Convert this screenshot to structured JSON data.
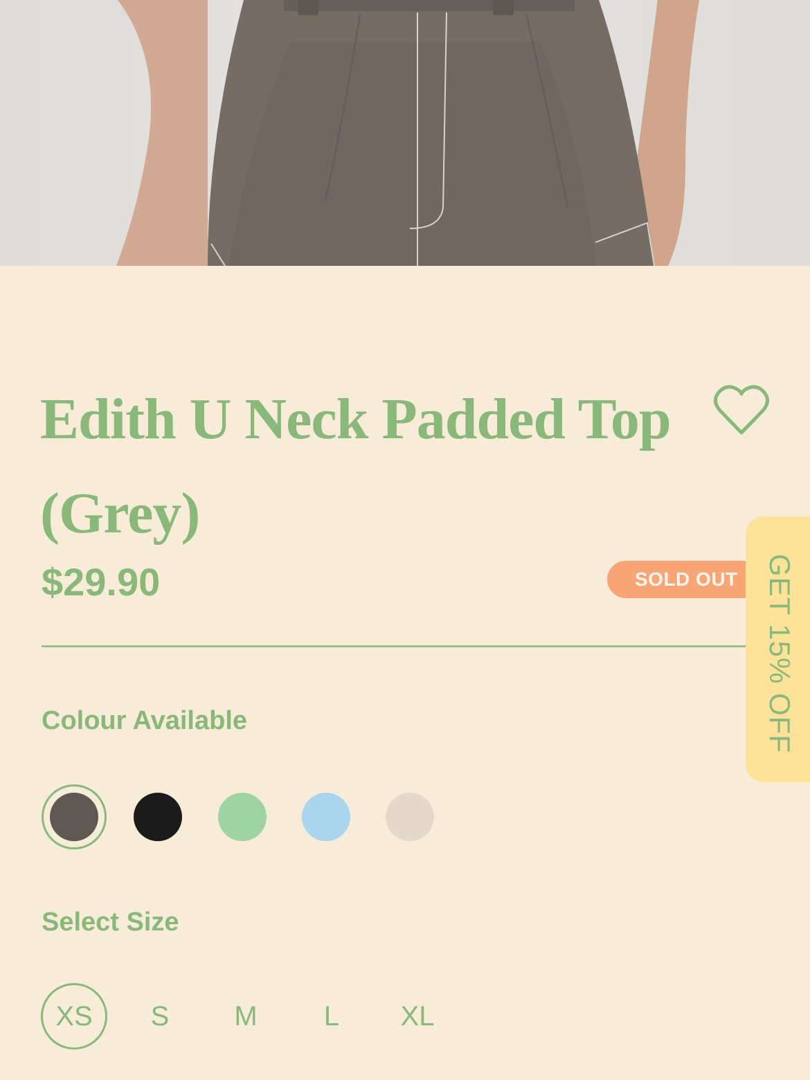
{
  "product": {
    "title": "Edith U Neck Padded Top (Grey)",
    "price": "$29.90",
    "status_badge": "SOLD OUT"
  },
  "colours": {
    "label": "Colour Available",
    "options": [
      {
        "color": "#5f5853",
        "selected": true
      },
      {
        "color": "#1b1b1b",
        "selected": false
      },
      {
        "color": "#a0d3a2",
        "selected": false
      },
      {
        "color": "#a9d6ec",
        "selected": false
      },
      {
        "color": "#e3d8cb",
        "selected": false
      }
    ]
  },
  "sizes": {
    "label": "Select Size",
    "options": [
      "XS",
      "S",
      "M",
      "L",
      "XL"
    ],
    "selected": "XS"
  },
  "promo": {
    "label": "GET 15% OFF"
  },
  "icons": {
    "wishlist": "heart-icon"
  },
  "theme": {
    "accent": "#8ab77a",
    "background": "#f7ecd8",
    "badge": "#f8a578",
    "promo": "#fde39a"
  }
}
